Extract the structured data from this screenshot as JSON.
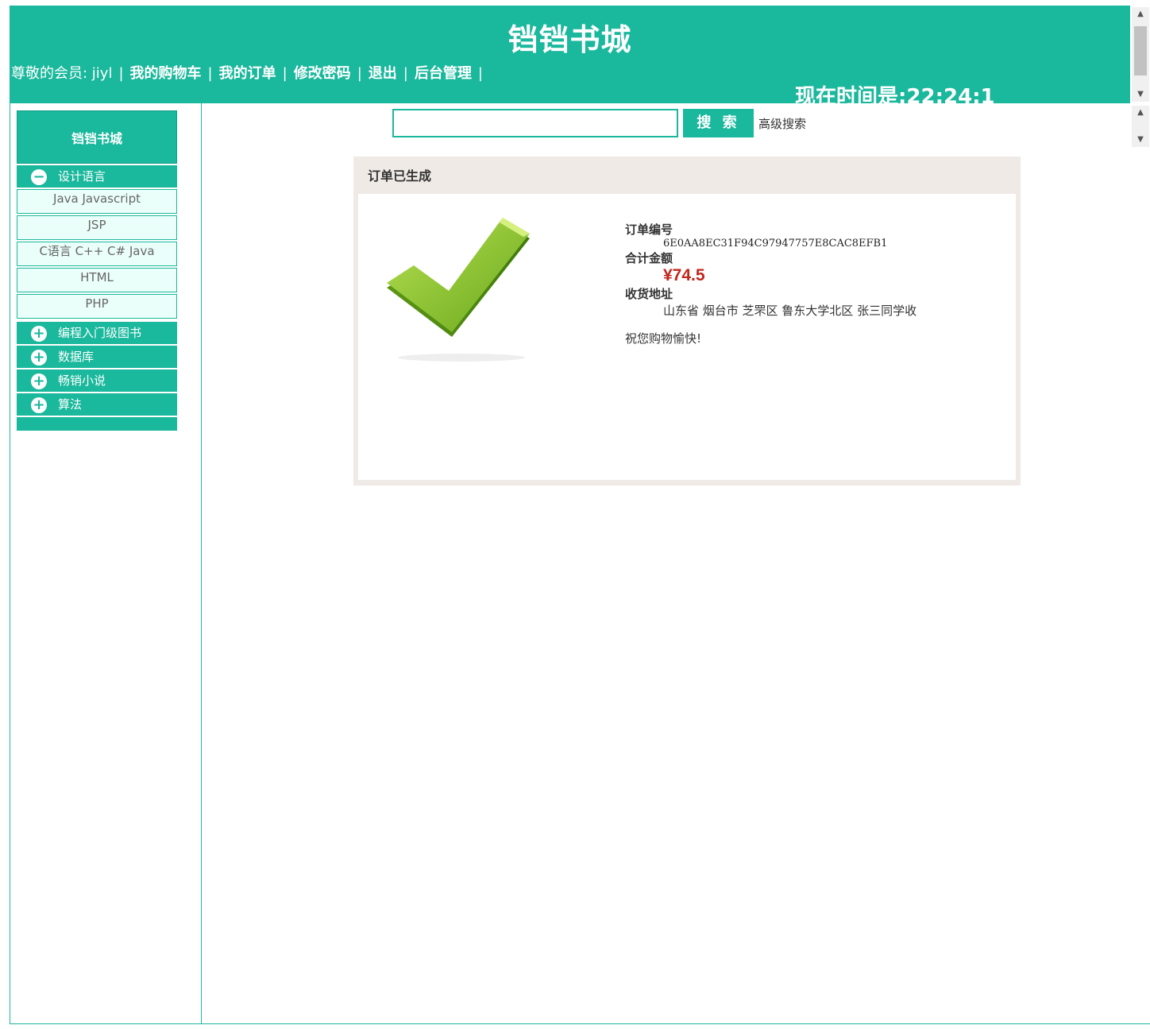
{
  "header": {
    "site_title": "铛铛书城",
    "greeting": "尊敬的会员: jiyl",
    "nav": [
      "我的购物车",
      "我的订单",
      "修改密码",
      "退出",
      "后台管理"
    ],
    "clock": "现在时间是:22:24:1"
  },
  "sidebar": {
    "title": "铛铛书城",
    "categories": [
      {
        "label": "设计语言",
        "expanded": true,
        "icon": "minus-circle-icon",
        "items": [
          "Java Javascript",
          "JSP",
          "C语言 C++ C# Java",
          "HTML",
          "PHP"
        ]
      },
      {
        "label": "编程入门级图书",
        "expanded": false,
        "icon": "plus-circle-icon"
      },
      {
        "label": "数据库",
        "expanded": false,
        "icon": "plus-circle-icon"
      },
      {
        "label": "畅销小说",
        "expanded": false,
        "icon": "plus-circle-icon"
      },
      {
        "label": "算法",
        "expanded": false,
        "icon": "plus-circle-icon"
      }
    ]
  },
  "search": {
    "value": "",
    "button_label": "搜 索",
    "advanced_label": "高级搜索"
  },
  "order": {
    "panel_title": "订单已生成",
    "order_no_label": "订单编号",
    "order_no": "6E0AA8EC31F94C97947757E8CAC8EFB1",
    "total_label": "合计金额",
    "total": "¥74.5",
    "address_label": "收货地址",
    "address": "山东省 烟台市 芝罘区 鲁东大学北区 张三同学收",
    "wish": "祝您购物愉快!"
  },
  "colors": {
    "accent": "#1ab89c",
    "price": "#c0261b",
    "panel_bg": "#efeae6",
    "check_green": "#8cc63f"
  }
}
